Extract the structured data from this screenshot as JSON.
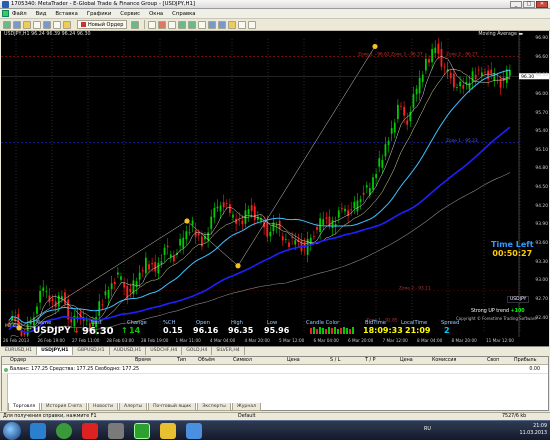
{
  "window": {
    "title": "1705340: MetaTrader - E-Global Trade & Finance Group - [USDJPY,H1]",
    "buttons": [
      "_",
      "□",
      "✕"
    ]
  },
  "menu": [
    "Файл",
    "Вид",
    "Вставка",
    "Графики",
    "Сервис",
    "Окна",
    "Справка"
  ],
  "toolbar": {
    "new_order_label": "Новый Ордер",
    "icons": [
      "new-chart-icon",
      "profiles-icon",
      "market-watch-icon",
      "data-window-icon",
      "navigator-icon",
      "terminal-icon",
      "tester-icon",
      "new-order-icon",
      "expert-advisors-icon",
      "bar-chart-icon",
      "candles-icon",
      "line-chart-icon",
      "zoom-in-icon",
      "zoom-out-icon",
      "tile-icon",
      "autoscroll-icon",
      "chart-shift-icon",
      "indicators-icon",
      "periods-icon",
      "templates-icon"
    ]
  },
  "chart": {
    "info": "USDJPY,H1  96.24 96.39 96.24 96.30",
    "ma_label": "Moving Average ▬",
    "zone1": "Zone 1 - 96.62",
    "zone2": "Zone 2 - 96.27",
    "zone3": "Zone 3 - 96.37",
    "zone1_left": "Zone 1 - 95.23",
    "zone2_mid": "Zone 2 - 93.11",
    "zone_low": "Zone 1 - 92.85",
    "time_left_label": "Time Left",
    "time_left_value": "00:50:27",
    "strong_label": "Strong UP trend",
    "strong_value": "+100",
    "pair_tag": "USDJPY",
    "watermark": "Copyright © Forextime Trading Software",
    "mt_label": "MT 611",
    "colors": {
      "bg": "#000000",
      "bull": "#00cc00",
      "bear": "#ff2020",
      "ma_blue": "#2020ff",
      "ma_cyan": "#40c0ff",
      "zone": "#ff3030"
    }
  },
  "chart_data": {
    "type": "candlestick",
    "symbol": "USDJPY",
    "timeframe": "H1",
    "ylim": [
      92.2,
      96.9
    ],
    "y_ticks": [
      "96.90",
      "96.60",
      "96.30",
      "96.00",
      "95.70",
      "95.40",
      "95.10",
      "94.80",
      "94.50",
      "94.20",
      "93.90",
      "93.60",
      "93.30",
      "93.00",
      "92.70",
      "92.40"
    ],
    "x_ticks": [
      "26 Feb 2013",
      "26 Feb 19:00",
      "27 Feb 11:00",
      "28 Feb 03:00",
      "28 Feb 19:00",
      "1 Mar 11:00",
      "4 Mar 04:00",
      "4 Mar 20:00",
      "5 Mar 12:00",
      "6 Mar 04:00",
      "6 Mar 20:00",
      "7 Mar 12:00",
      "8 Mar 04:00",
      "8 Mar 20:00",
      "11 Mar 12:00"
    ],
    "close_series": [
      92.4,
      92.1,
      92.5,
      92.9,
      92.6,
      92.8,
      92.3,
      92.5,
      92.2,
      92.6,
      92.9,
      93.1,
      92.8,
      93.0,
      93.3,
      93.2,
      93.5,
      93.4,
      93.7,
      93.9,
      93.6,
      94.0,
      94.3,
      94.1,
      93.9,
      94.2,
      94.0,
      93.8,
      93.9,
      93.6,
      93.7,
      93.5,
      93.8,
      94.0,
      93.9,
      94.2,
      94.1,
      94.4,
      94.5,
      94.9,
      95.3,
      95.8,
      95.6,
      96.1,
      96.5,
      96.8,
      96.4,
      96.2,
      96.1,
      96.3,
      96.4,
      96.3,
      96.2,
      96.4
    ]
  },
  "info_panel": {
    "headers": [
      "Name",
      "Last",
      "Change",
      "%CH",
      "Open",
      "High",
      "Low",
      "Candle Color",
      "BidTime",
      "LocalTime",
      "Spread"
    ],
    "values": {
      "name": "USDJPY",
      "last": "96.30",
      "change": "14",
      "pch": "0.15",
      "open": "96.16",
      "high": "96.35",
      "low": "95.96",
      "candle": "",
      "bidtime": "18:09:33",
      "localtime": "21:09",
      "spread": "2"
    }
  },
  "chart_tabs": [
    "EURUSD,H1",
    "USDJPY,H1",
    "GBPUSD,H1",
    "AUDUSD,H1",
    "USDCHF,H4",
    "GOLD,H4",
    "SILVER,H4"
  ],
  "terminal": {
    "columns": [
      "Ордер",
      "Время",
      "Тип",
      "Объём",
      "Символ",
      "Цена",
      "S / L",
      "T / P",
      "Цена",
      "Комиссия",
      "Своп",
      "Прибыль"
    ],
    "balance_row": "Баланс: 177.25  Средства: 177.25  Свободно: 177.25",
    "profit": "0.00",
    "tabs": [
      "Торговля",
      "История Счета",
      "Новости",
      "Алерты",
      "Почтовый ящик",
      "Эксперты",
      "Журнал"
    ]
  },
  "status": {
    "left": "Для получения справки, нажмите F1",
    "middle": "Default",
    "right": "7527/6 kb"
  },
  "taskbar": {
    "lang": "RU",
    "time": "21:09",
    "date": "11.03.2013"
  }
}
